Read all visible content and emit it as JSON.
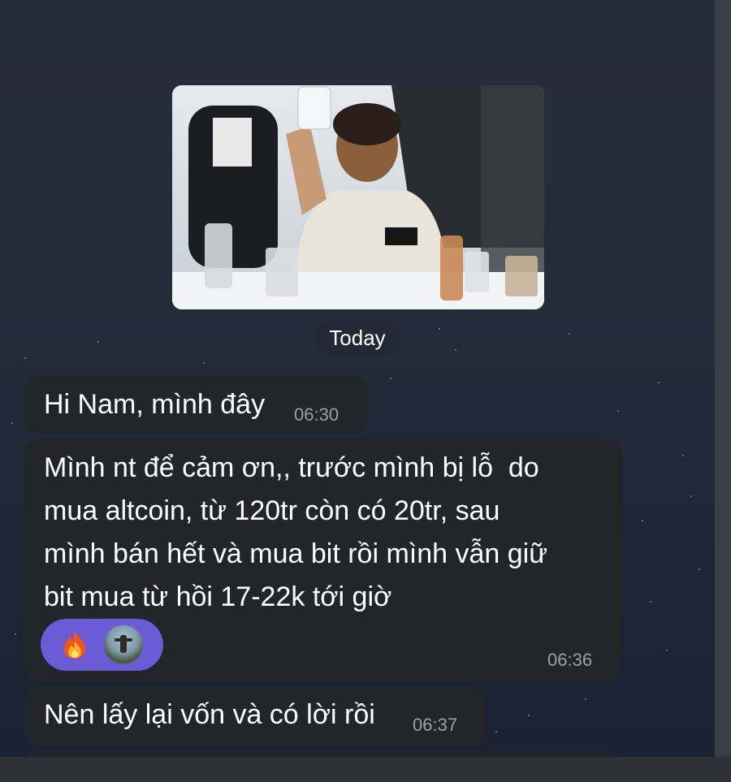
{
  "date_separator": "Today",
  "messages": [
    {
      "text": "Hi Nam, mình đây",
      "time": "06:30"
    },
    {
      "lines": [
        "Mình nt để cảm ơn,, trước mình bị lỗ  do",
        "mua altcoin, từ 120tr còn có 20tr, sau",
        "mình bán hết và mua bit rồi mình vẫn giữ",
        "bit mua từ hồi 17-22k tới giờ"
      ],
      "time": "06:36",
      "reactions": [
        "fire",
        "user-avatar"
      ]
    },
    {
      "text": "Nên lấy lại vốn và có lời rồi",
      "time": "06:37"
    }
  ],
  "colors": {
    "bubble": "#23252b",
    "reaction_pill": "#6d5bd6",
    "time_text": "#9aa0a6",
    "background": "#262d3a"
  }
}
